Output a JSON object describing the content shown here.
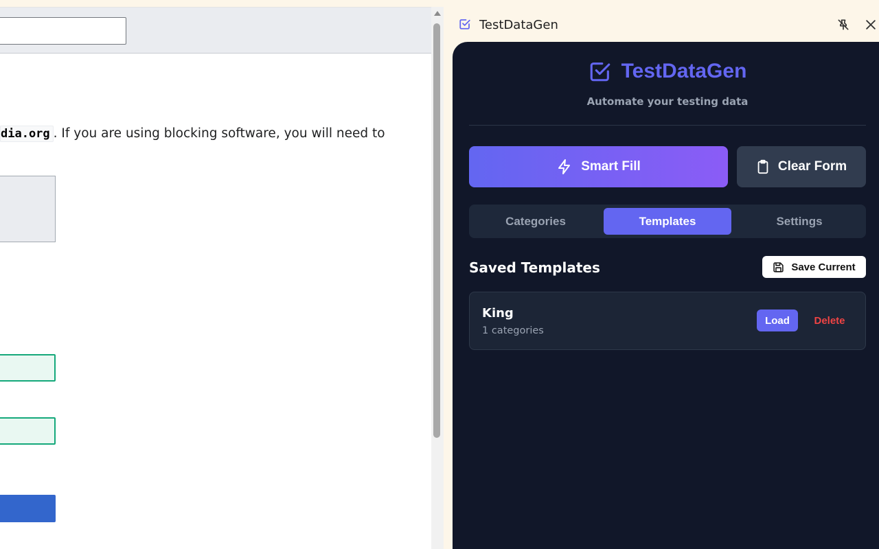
{
  "webpage": {
    "code_text": "dia.org",
    "body_text": ". If you are using blocking software, you will need to"
  },
  "panel": {
    "title": "TestDataGen",
    "icons": [
      "checkbox-logo-icon",
      "unpin-icon",
      "close-icon"
    ]
  },
  "app": {
    "brand": "TestDataGen",
    "tagline": "Automate your testing data",
    "smart_fill_label": "Smart Fill",
    "clear_form_label": "Clear Form",
    "tabs": [
      {
        "label": "Categories",
        "active": false
      },
      {
        "label": "Templates",
        "active": true
      },
      {
        "label": "Settings",
        "active": false
      }
    ],
    "saved_templates_title": "Saved Templates",
    "save_current_label": "Save Current",
    "templates": [
      {
        "name": "King",
        "subtitle": "1 categories",
        "load_label": "Load",
        "delete_label": "Delete"
      }
    ]
  },
  "colors": {
    "accent": "#6366f1",
    "gradient_end": "#8b5cf6",
    "panel_bg": "#111729",
    "danger": "#ef4444"
  }
}
